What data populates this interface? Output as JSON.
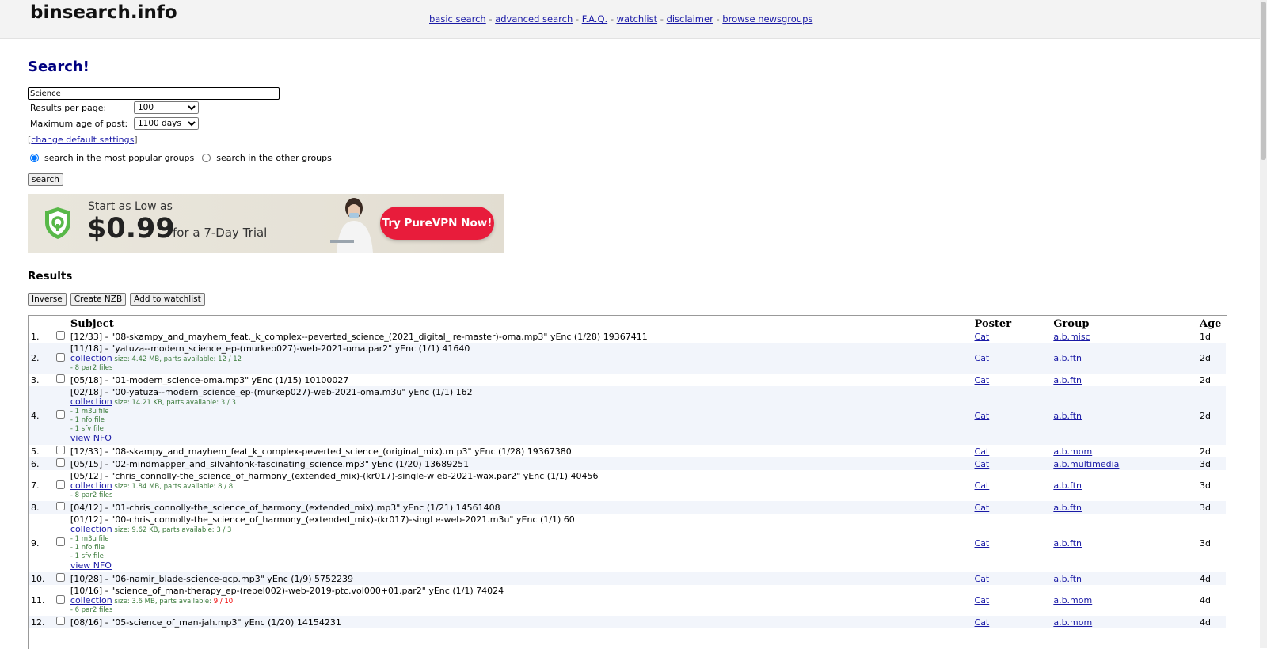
{
  "site": {
    "logo": "binsearch.info"
  },
  "nav": [
    {
      "label": "basic search"
    },
    {
      "label": "advanced search"
    },
    {
      "label": "F.A.Q."
    },
    {
      "label": "watchlist"
    },
    {
      "label": "disclaimer"
    },
    {
      "label": "browse newsgroups"
    }
  ],
  "nav_sep": "-",
  "search": {
    "heading": "Search!",
    "query": "Science",
    "results_per_page_label": "Results per page:",
    "results_per_page": "100",
    "max_age_label": "Maximum age of post:",
    "max_age": "1100 days",
    "change_settings": "change default settings",
    "bracket_open": "[",
    "bracket_close": "]",
    "radio_popular": "search in the most popular groups",
    "radio_other": "search in the other groups",
    "button": "search"
  },
  "ad": {
    "start": "Start as Low as",
    "price": "$0.99",
    "trial": "for a 7-Day Trial",
    "cta": "Try PureVPN Now!",
    "accent": "#e81c3b",
    "shield_color": "#58b848"
  },
  "results": {
    "heading": "Results",
    "buttons": {
      "inverse": "Inverse",
      "nzb": "Create NZB",
      "watch": "Add to watchlist"
    },
    "columns": {
      "subject": "Subject",
      "poster": "Poster",
      "group": "Group",
      "age": "Age"
    },
    "rows": [
      {
        "num": "1.",
        "subject": "[12/33] - \"08-skampy_and_mayhem_feat._k_complex--peverted_science_(2021_digital_ re-master)-oma.mp3\" yEnc (1/28) 19367411",
        "poster": "Cat",
        "group": "a.b.misc",
        "age": "1d"
      },
      {
        "num": "2.",
        "subject": "[11/18] - \"yatuza--modern_science_ep-(murkep027)-web-2021-oma.par2\" yEnc (1/1) 41640",
        "collection": "collection",
        "size": " size: 4.42 MB, parts available: 12 / 12",
        "files": [
          "- 8 par2 files"
        ],
        "poster": "Cat",
        "group": "a.b.ftn",
        "age": "2d"
      },
      {
        "num": "3.",
        "subject": "[05/18] - \"01-modern_science-oma.mp3\" yEnc (1/15) 10100027",
        "poster": "Cat",
        "group": "a.b.ftn",
        "age": "2d"
      },
      {
        "num": "4.",
        "subject": "[02/18] - \"00-yatuza--modern_science_ep-(murkep027)-web-2021-oma.m3u\" yEnc (1/1) 162",
        "collection": "collection",
        "size": " size: 14.21 KB, parts available: 3 / 3",
        "files": [
          "- 1 m3u file",
          "- 1 nfo file",
          "- 1 sfv file"
        ],
        "nfo": "view NFO",
        "poster": "Cat",
        "group": "a.b.ftn",
        "age": "2d"
      },
      {
        "num": "5.",
        "subject": "[12/33] - \"08-skampy_and_mayhem_feat_k_complex-peverted_science_(original_mix).m p3\" yEnc (1/28) 19367380",
        "poster": "Cat",
        "group": "a.b.mom",
        "age": "2d"
      },
      {
        "num": "6.",
        "subject": "[05/15] - \"02-mindmapper_and_silvahfonk-fascinating_science.mp3\" yEnc (1/20) 13689251",
        "poster": "Cat",
        "group": "a.b.multimedia",
        "age": "3d"
      },
      {
        "num": "7.",
        "subject": "[05/12] - \"chris_connolly-the_science_of_harmony_(extended_mix)-(kr017)-single-w eb-2021-wax.par2\" yEnc (1/1) 40456",
        "collection": "collection",
        "size": " size: 1.84 MB, parts available: 8 / 8",
        "files": [
          "- 8 par2 files"
        ],
        "poster": "Cat",
        "group": "a.b.ftn",
        "age": "3d"
      },
      {
        "num": "8.",
        "subject": "[04/12] - \"01-chris_connolly-the_science_of_harmony_(extended_mix).mp3\" yEnc (1/21) 14561408",
        "poster": "Cat",
        "group": "a.b.ftn",
        "age": "3d"
      },
      {
        "num": "9.",
        "subject": "[01/12] - \"00-chris_connolly-the_science_of_harmony_(extended_mix)-(kr017)-singl e-web-2021.m3u\" yEnc (1/1) 60",
        "collection": "collection",
        "size": " size: 9.62 KB, parts available: 3 / 3",
        "files": [
          "- 1 m3u file",
          "- 1 nfo file",
          "- 1 sfv file"
        ],
        "nfo": "view NFO",
        "poster": "Cat",
        "group": "a.b.ftn",
        "age": "3d"
      },
      {
        "num": "10.",
        "subject": "[10/28] - \"06-namir_blade-science-gcp.mp3\" yEnc (1/9) 5752239",
        "poster": "Cat",
        "group": "a.b.ftn",
        "age": "4d"
      },
      {
        "num": "11.",
        "subject": "[10/16] - \"science_of_man-therapy_ep-(rebel002)-web-2019-ptc.vol000+01.par2\" yEnc (1/1) 74024",
        "collection": "collection",
        "size": " size: 3.6 MB, parts available: ",
        "parts_red": "9 / 10",
        "files": [
          "- 6 par2 files"
        ],
        "poster": "Cat",
        "group": "a.b.mom",
        "age": "4d"
      },
      {
        "num": "12.",
        "subject": "[08/16] - \"05-science_of_man-jah.mp3\" yEnc (1/20) 14154231",
        "poster": "Cat",
        "group": "a.b.mom",
        "age": "4d"
      }
    ]
  }
}
